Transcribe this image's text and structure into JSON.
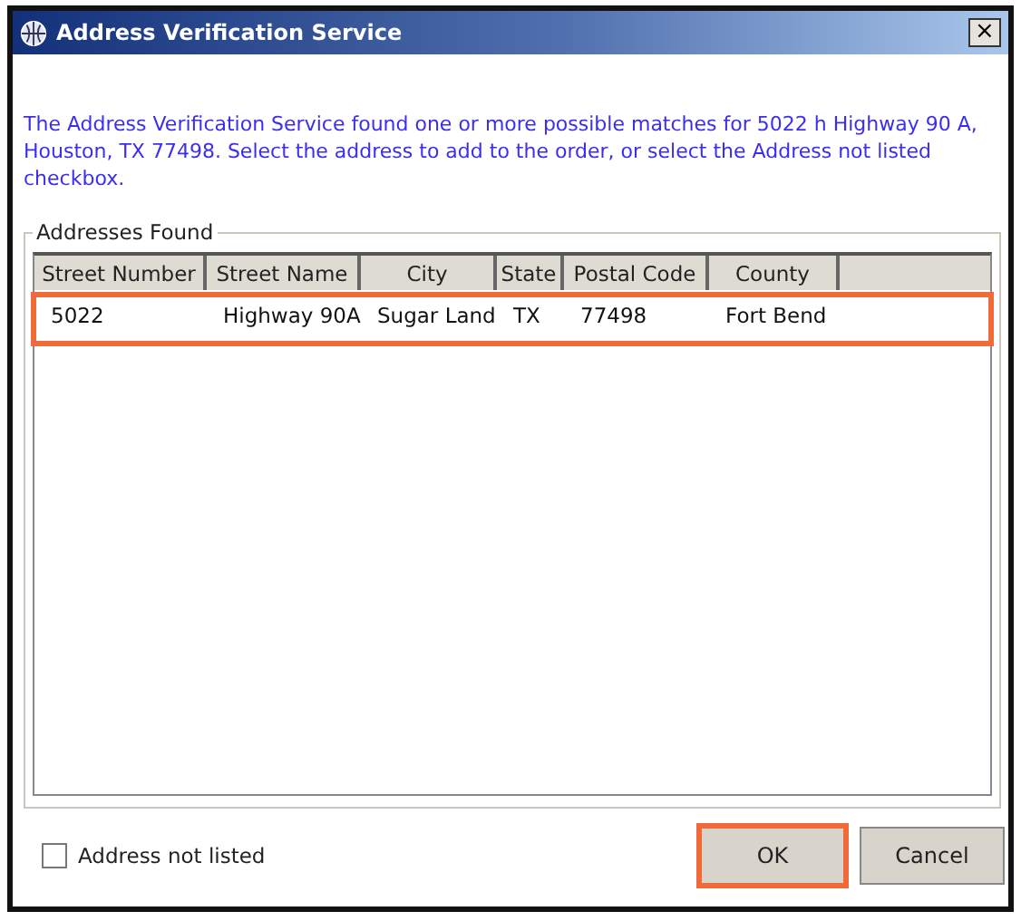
{
  "window": {
    "title": "Address Verification Service",
    "close": "×"
  },
  "message": "The Address Verification Service found one or more possible matches for 5022 h Highway 90 A, Houston, TX 77498. Select the address to add to the order, or select the Address not listed checkbox.",
  "group": {
    "label": "Addresses Found"
  },
  "table": {
    "columns": [
      "Street Number",
      "Street Name",
      "City",
      "State",
      "Postal Code",
      "County"
    ],
    "rows": [
      {
        "cells": [
          "5022",
          "Highway 90A",
          "Sugar Land",
          "TX",
          "77498",
          "Fort Bend"
        ],
        "highlighted": true
      }
    ]
  },
  "not_listed": {
    "label": "Address not listed",
    "checked": false
  },
  "buttons": [
    {
      "label": "OK",
      "highlighted": true
    },
    {
      "label": "Cancel",
      "highlighted": false
    }
  ]
}
